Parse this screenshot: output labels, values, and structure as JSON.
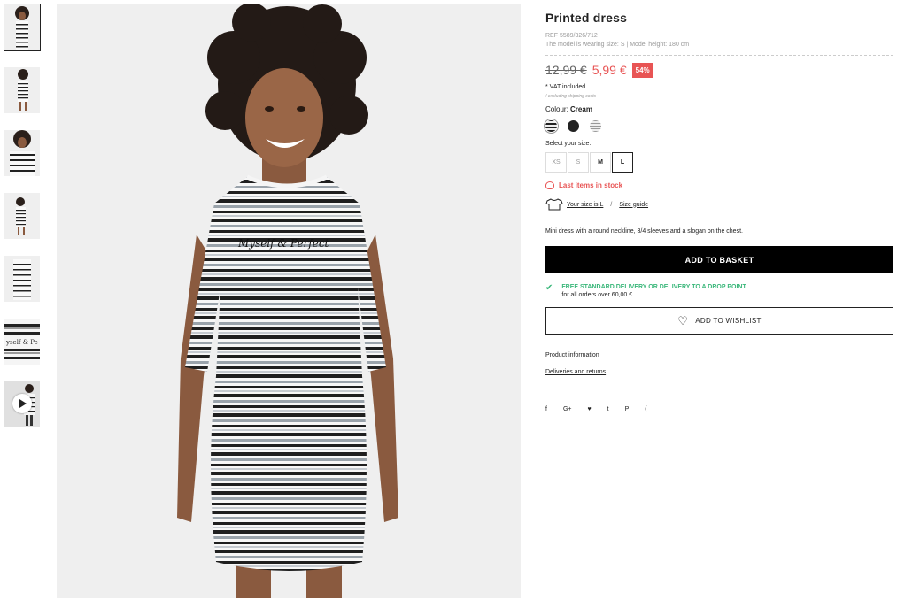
{
  "product": {
    "title": "Printed dress",
    "ref": "REF 5589/326/712",
    "model_info": "The model is wearing size: S | Model height: 180 cm",
    "old_price": "12,99 €",
    "new_price": "5,99 €",
    "discount": "54%",
    "vat": "* VAT included",
    "shipping_note": "/ excluding shipping costs",
    "colour_label": "Colour:",
    "colour_value": "Cream",
    "swatches": [
      {
        "name": "cream-stripe",
        "color": "#d9d9d9",
        "selected": true
      },
      {
        "name": "black",
        "color": "#222222",
        "selected": false
      },
      {
        "name": "grey-stripe",
        "color": "#bbbbbb",
        "selected": false
      }
    ],
    "size_label": "Select your size:",
    "sizes": [
      "XS",
      "S",
      "M",
      "L"
    ],
    "selected_size": "L",
    "stock_text": "Last items in stock",
    "your_size": "Your size is L",
    "size_guide": "Size guide",
    "description": "Mini dress with a round neckline, 3/4 sleeves and a slogan on the chest.",
    "add_to_basket": "ADD TO BASKET",
    "delivery_title": "FREE STANDARD DELIVERY OR DELIVERY TO A DROP POINT",
    "delivery_sub": "for all orders over 60,00 €",
    "wishlist": "ADD TO WISHLIST",
    "product_info": "Product information",
    "deliveries": "Deliveries and returns",
    "share": [
      "f",
      "G+",
      "♥",
      "t",
      "P",
      "("
    ],
    "dress_slogan": "Myself & Perfect"
  },
  "colors": {
    "accent_red": "#e85454",
    "success_green": "#3ab77a",
    "button_black": "#000000"
  }
}
